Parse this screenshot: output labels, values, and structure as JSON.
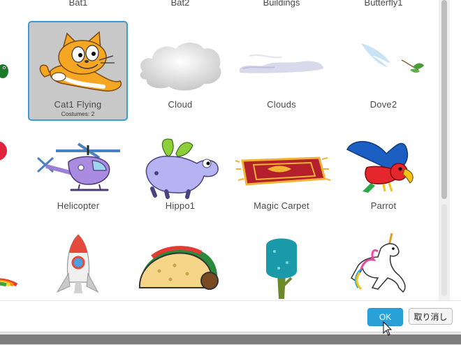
{
  "top_row": [
    "Bat1",
    "Bat2",
    "Buildings",
    "Butterfly1"
  ],
  "rows": [
    [
      {
        "name": "Cat1 Flying",
        "costumes": "Costumes: 2",
        "selected": true
      },
      {
        "name": "Cloud"
      },
      {
        "name": "Clouds"
      },
      {
        "name": "Dove2"
      }
    ],
    [
      {
        "name": "Helicopter"
      },
      {
        "name": "Hippo1"
      },
      {
        "name": "Magic Carpet"
      },
      {
        "name": "Parrot"
      }
    ]
  ],
  "footer": {
    "ok_label": "OK",
    "cancel_label": "取り消し"
  },
  "colors": {
    "accent": "#2aa2d8",
    "selected_bg": "#c8c8c8",
    "selected_border": "#3d9ad6"
  }
}
